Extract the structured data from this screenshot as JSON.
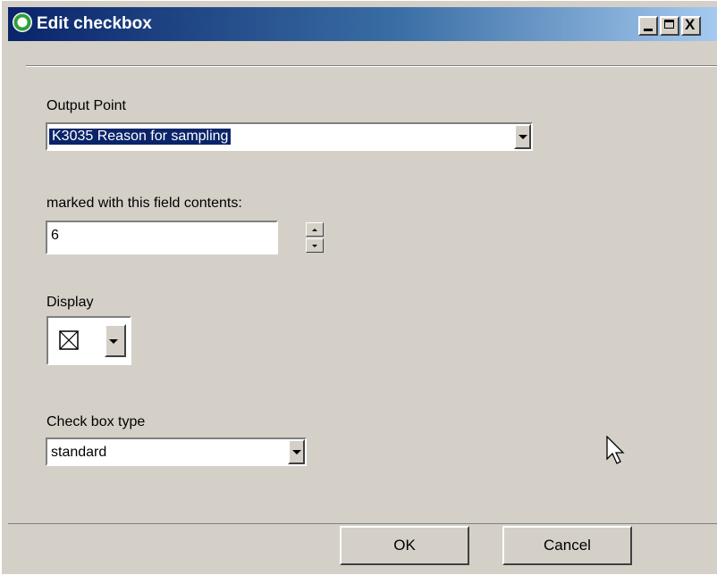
{
  "window": {
    "title": "Edit checkbox",
    "controls": {
      "minimize": "_",
      "maximize": "□",
      "close": "X"
    }
  },
  "output_point": {
    "label": "Output Point",
    "value": "K3035 Reason for sampling"
  },
  "field_contents": {
    "label": "marked with this field contents:",
    "value": "6"
  },
  "display": {
    "label": "Display",
    "icon": "checkbox-x-icon"
  },
  "check_box_type": {
    "label": "Check box type",
    "value": "standard"
  },
  "buttons": {
    "ok": "OK",
    "cancel": "Cancel"
  },
  "colors": {
    "dialog_bg": "#d4d0c8",
    "title_gradient_start": "#0a246a",
    "selection": "#0a246a"
  }
}
